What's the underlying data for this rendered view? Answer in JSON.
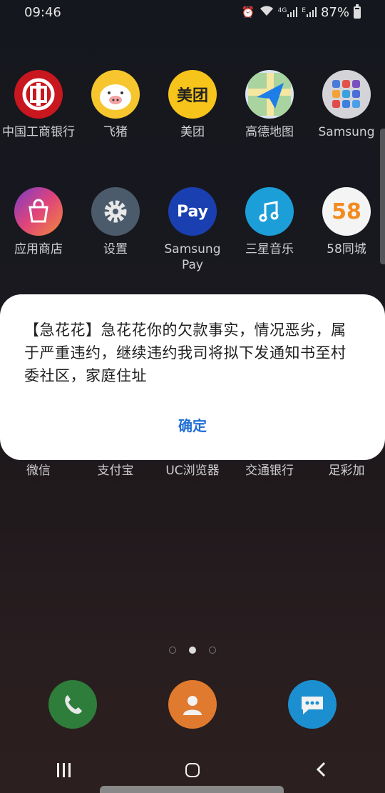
{
  "status_bar": {
    "time": "09:46",
    "network": "4G",
    "signal2": "E",
    "battery": "87%"
  },
  "home_rows": [
    [
      {
        "label": "中国工商银行",
        "icon": "icbc-icon"
      },
      {
        "label": "飞猪",
        "icon": "fliggy-icon"
      },
      {
        "label": "美团",
        "icon": "meituan-icon",
        "glyph": "美团"
      },
      {
        "label": "高德地图",
        "icon": "amap-icon"
      },
      {
        "label": "Samsung",
        "icon": "samsung-folder-icon"
      }
    ],
    [
      {
        "label": "应用商店",
        "icon": "app-store-icon"
      },
      {
        "label": "设置",
        "icon": "settings-icon"
      },
      {
        "label": "Samsung Pay",
        "icon": "samsung-pay-icon",
        "glyph": "Pay"
      },
      {
        "label": "三星音乐",
        "icon": "music-icon"
      },
      {
        "label": "58同城",
        "icon": "58-icon",
        "glyph": "58"
      }
    ],
    [
      {
        "label": "微信",
        "icon": "wechat-icon"
      },
      {
        "label": "支付宝",
        "icon": "alipay-icon"
      },
      {
        "label": "UC浏览器",
        "icon": "uc-browser-icon"
      },
      {
        "label": "交通银行",
        "icon": "bocom-icon"
      },
      {
        "label": "足彩加",
        "icon": "lottery-icon"
      }
    ]
  ],
  "dialog": {
    "message": "【急花花】急花花你的欠款事实，情况恶劣，属于严重违约，继续违约我司将拟下发通知书至村委社区，家庭住址",
    "ok_label": "确定"
  },
  "dock": [
    {
      "icon": "phone-icon"
    },
    {
      "icon": "contacts-icon"
    },
    {
      "icon": "messages-icon"
    }
  ],
  "colors": {
    "accent": "#1f6ed4"
  }
}
